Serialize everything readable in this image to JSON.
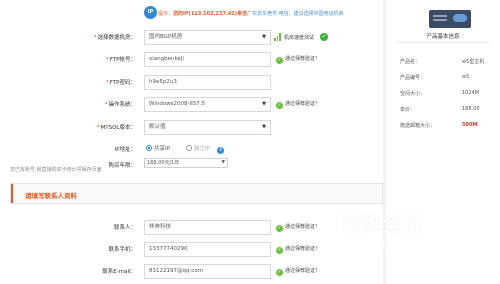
{
  "notice": {
    "badge": "IP",
    "prefix": "提示：",
    "highlight": "您的IP(113.102.237.41)来自",
    "rest": "广东省东莞市 电信，建议选择中国电信机房"
  },
  "form": {
    "datacenter": {
      "label": "选择数据机房：",
      "value": "国内BGP机房",
      "speed_test": "机房速度测试"
    },
    "ftp_account": {
      "label": "FTP帐号：",
      "value": "xiangbenkeji",
      "tip": "通过保荐验证！"
    },
    "ftp_password": {
      "label": "FTP密码：",
      "value": "h9e5p2u3"
    },
    "os": {
      "label": "操作系统：",
      "value": "Windows2008-IIS7.5",
      "tip": "通过保荐验证！"
    },
    "mysql": {
      "label": "MYSQL版本：",
      "value": "默认值"
    },
    "ip_address": {
      "label": "IP地址：",
      "options": [
        {
          "text": "共享IP",
          "selected": true
        },
        {
          "text": "独立IP",
          "selected": false
        }
      ],
      "info_icon": "i"
    },
    "term": {
      "label": "购买年限：",
      "value": "188.00元/1年"
    },
    "note": "您已有账号,就直接购买卡统计并保存页面"
  },
  "contact": {
    "section_title": "请填写联系人资料",
    "name": {
      "label": "联系人：",
      "value": "祥奔科技",
      "tip": "通过保荐验证！"
    },
    "phone": {
      "label": "联系手机：",
      "value": "13377740290",
      "tip": "通过保荐验证！"
    },
    "email": {
      "label": "联系E-mail：",
      "value": "83122197@qq.com",
      "tip": "通过保荐验证！"
    }
  },
  "sidebar": {
    "title": "产品基本信息",
    "rows": [
      {
        "k": "产品名：",
        "v": "w5型主机",
        "red": false
      },
      {
        "k": "产品编号：",
        "v": "w5",
        "red": false
      },
      {
        "k": "空间大小：",
        "v": "1024M",
        "red": false
      },
      {
        "k": "单价：",
        "v": "188.00",
        "red": false
      },
      {
        "k": "赠送邮箱大小：",
        "v": "500M",
        "red": true
      }
    ]
  },
  "watermark": {
    "line1": "百科全说",
    "line2": "助你轻松解决"
  },
  "colors": {
    "accent": "#e85a29",
    "link": "#2b8bd8",
    "ok": "#6cbf3c"
  }
}
